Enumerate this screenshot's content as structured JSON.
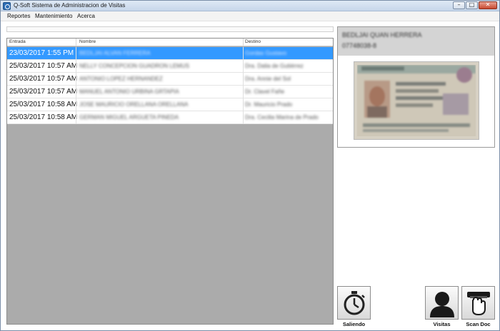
{
  "window": {
    "title": "Q-Soft Sistema de Administracion de Visitas",
    "controls": {
      "minimize": "–",
      "maximize": "□",
      "close": "✕"
    }
  },
  "menu": [
    "Reportes",
    "Mantenimiento",
    "Acerca"
  ],
  "table": {
    "columns": [
      "Entrada",
      "Nombre",
      "Destino"
    ],
    "selected_row": 0,
    "rows": [
      {
        "entrada": "23/03/2017 1:55 PM",
        "nombre": "BEDLJAI ALVAN FERRERA",
        "destino": "Gordas Gustavo"
      },
      {
        "entrada": "25/03/2017 10:57 AM",
        "nombre": "NELLY CONCEPCION GUADRON LEMUS",
        "destino": "Dra. Dalia de Gutiérrez"
      },
      {
        "entrada": "25/03/2017 10:57 AM",
        "nombre": "ANTONIO LOPEZ HERNANDEZ",
        "destino": "Dra. Annie del Sol"
      },
      {
        "entrada": "25/03/2017 10:57 AM",
        "nombre": "MANUEL ANTONIO URBINA GRTAPIA",
        "destino": "Dr. Clavel Fañe"
      },
      {
        "entrada": "25/03/2017 10:58 AM",
        "nombre": "JOSE MAURICIO ORELLANA ORELLANA",
        "destino": "Dr. Mauricio Prado"
      },
      {
        "entrada": "25/03/2017 10:58 AM",
        "nombre": "GERMAN MIGUEL ARGUETA PINEDA",
        "destino": "Dra. Cecilia Marina de Prado"
      }
    ]
  },
  "visitor": {
    "name": "BEDLJAI QUAN HERRERA",
    "document": "07748038-8"
  },
  "buttons": {
    "saliendo": "Saliendo",
    "visitas": "Visitas",
    "scan_doc": "Scan Doc"
  },
  "icons": {
    "app": "app-icon",
    "saliendo": "stopwatch-icon",
    "visitas": "person-icon",
    "scan_doc": "scanner-hand-icon"
  },
  "colors": {
    "selection": "#3399ff",
    "grid_background": "#ababab",
    "visitor_header": "#d4d4d4"
  }
}
